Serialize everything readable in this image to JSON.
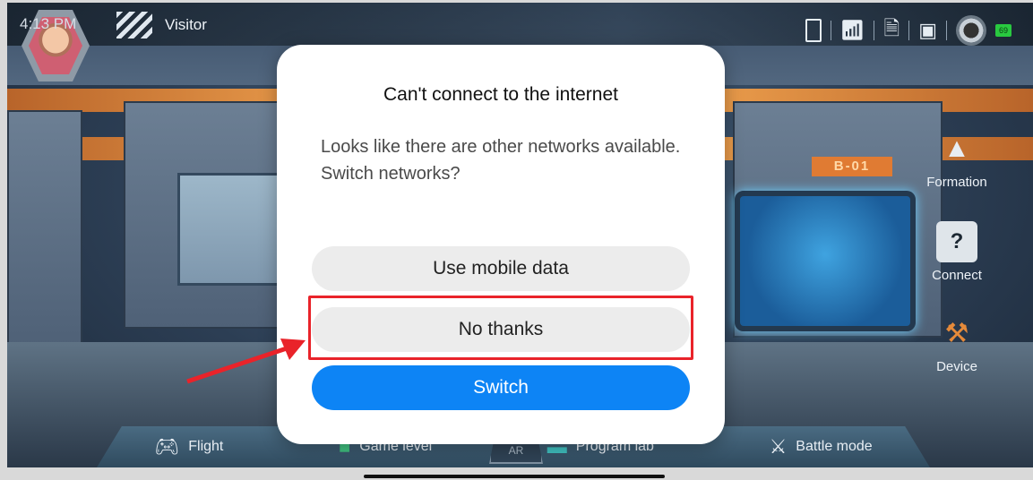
{
  "status_bar": {
    "time": "4:13 PM"
  },
  "user": {
    "name": "Visitor"
  },
  "status_icons": {
    "battery_level": "69"
  },
  "scene": {
    "room_label": "B-01",
    "ar_label": "AR"
  },
  "side_menu": [
    {
      "label": "Formation",
      "icon": "formation-icon"
    },
    {
      "label": "Connect",
      "icon": "help-icon"
    },
    {
      "label": "Device",
      "icon": "tools-icon"
    }
  ],
  "bottom_nav": [
    {
      "label": "Flight",
      "icon": "gamepad-icon"
    },
    {
      "label": "Game level",
      "icon": "game-level-icon"
    },
    {
      "label": "Program lab",
      "icon": "program-icon"
    },
    {
      "label": "Battle mode",
      "icon": "battle-icon"
    }
  ],
  "dialog": {
    "title": "Can't connect to the internet",
    "message": "Looks like there are other networks available. Switch networks?",
    "buttons": {
      "mobile_data": "Use mobile data",
      "no_thanks": "No thanks",
      "switch": "Switch"
    }
  },
  "colors": {
    "switch_button": "#0d84f5",
    "highlight": "#e9232a"
  }
}
